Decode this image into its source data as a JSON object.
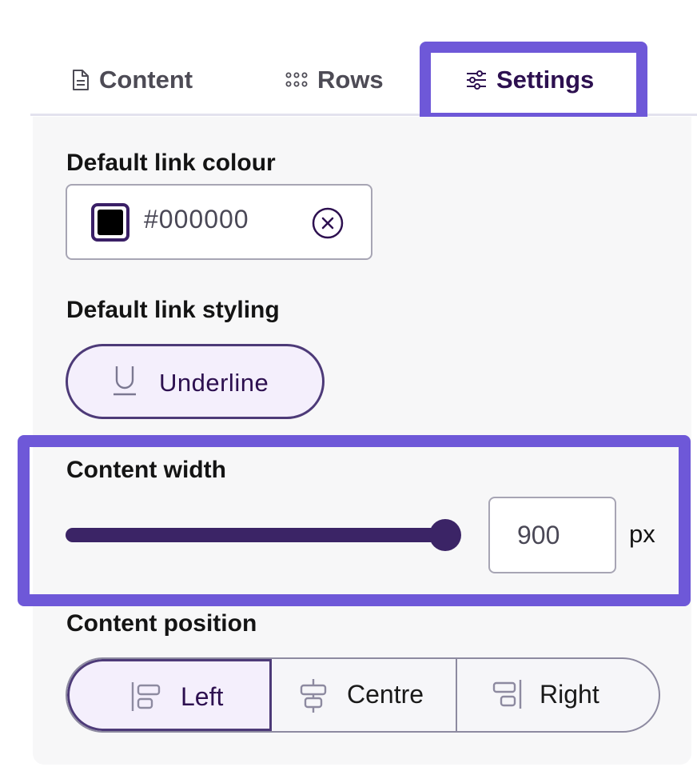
{
  "tabs": [
    {
      "label": "Content",
      "icon": "document-icon"
    },
    {
      "label": "Rows",
      "icon": "grid-dots-icon"
    },
    {
      "label": "Settings",
      "icon": "sliders-icon",
      "active": true
    }
  ],
  "link_colour": {
    "label": "Default link colour",
    "value": "#000000",
    "swatch_color": "#000000"
  },
  "link_styling": {
    "label": "Default link styling",
    "option": "Underline",
    "icon": "underline-icon"
  },
  "content_width": {
    "label": "Content width",
    "value": "900",
    "unit": "px",
    "slider_level": 1.0
  },
  "content_position": {
    "label": "Content position",
    "options": [
      {
        "label": "Left",
        "icon": "align-left-icon",
        "selected": true
      },
      {
        "label": "Centre",
        "icon": "align-center-icon",
        "selected": false
      },
      {
        "label": "Right",
        "icon": "align-right-icon",
        "selected": false
      }
    ]
  },
  "colors": {
    "accent": "#6e58d8",
    "primary_dark": "#3b2466",
    "selected_bg": "#f4effc"
  }
}
